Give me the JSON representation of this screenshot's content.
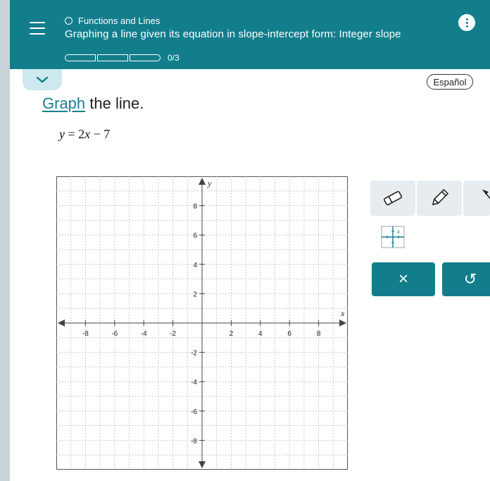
{
  "header": {
    "breadcrumb": "Functions and Lines",
    "title": "Graphing a line given its equation in slope-intercept form: Integer slope",
    "progress_label": "0/3",
    "progress_fraction": 0,
    "progress_segments": 3
  },
  "language_button": "Español",
  "problem": {
    "prompt_link": "Graph",
    "prompt_rest": " the line.",
    "eq_y": "y",
    "eq_eq": " = 2",
    "eq_x": "x",
    "eq_tail": " − 7"
  },
  "graph": {
    "x_label": "x",
    "y_label": "y",
    "x_ticks": [
      -8,
      -6,
      -4,
      -2,
      2,
      4,
      6,
      8
    ],
    "y_ticks": [
      8,
      6,
      4,
      2,
      -2,
      -4,
      -6,
      -8
    ],
    "xlim": [
      -10,
      10
    ],
    "ylim": [
      -10,
      10
    ],
    "grid": true
  },
  "tools": {
    "clear_symbol": "×",
    "undo_symbol": "↺"
  },
  "colors": {
    "header_bg": "#127e8c",
    "accent_light": "#cde8ee",
    "tool_bg": "#e6ecf0"
  }
}
